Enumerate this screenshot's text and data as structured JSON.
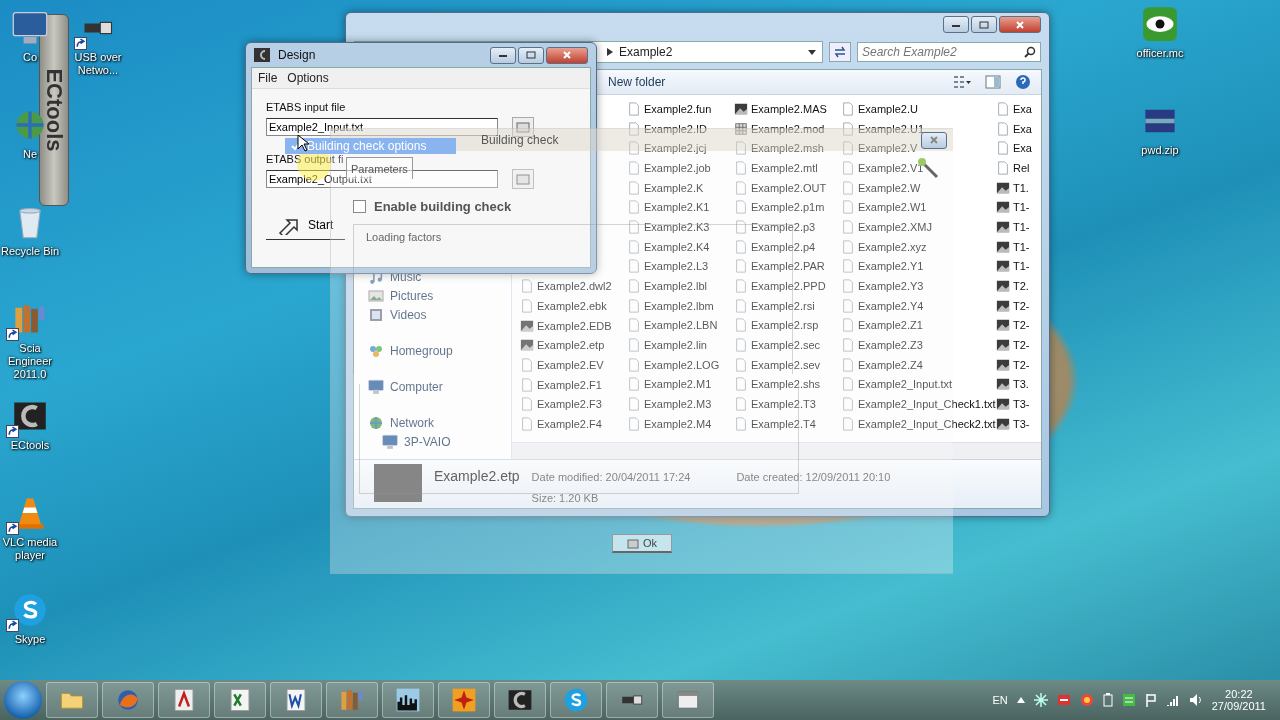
{
  "desktop": {
    "left_columns": [
      [
        {
          "label": "Co",
          "kind": "computer",
          "shortcut": false
        },
        {
          "label": "Ne",
          "kind": "network",
          "shortcut": false
        },
        {
          "label": "Recycle Bin",
          "kind": "recycle",
          "shortcut": false
        },
        {
          "label": "Scia Engineer 2011.0",
          "kind": "books",
          "shortcut": true
        },
        {
          "label": "ECtools",
          "kind": "ec",
          "shortcut": true
        },
        {
          "label": "VLC media player",
          "kind": "cone",
          "shortcut": true
        },
        {
          "label": "Skype",
          "kind": "skype",
          "shortcut": true
        }
      ],
      [
        {
          "label": "USB over Netwo...",
          "kind": "usb",
          "shortcut": true
        }
      ]
    ],
    "right_column": [
      {
        "label": "officer.mc",
        "kind": "eye",
        "shortcut": false
      },
      {
        "label": "pwd.zip",
        "kind": "archive",
        "shortcut": false
      }
    ],
    "gadget": {
      "label": "ECtools"
    }
  },
  "explorer": {
    "address": "Example2",
    "search": {
      "placeholder": "Search Example2"
    },
    "toolbar": [
      "New folder"
    ],
    "nav": [
      [
        {
          "label": "Music",
          "kind": "music"
        },
        {
          "label": "Pictures",
          "kind": "pictures"
        },
        {
          "label": "Videos",
          "kind": "videos"
        }
      ],
      [
        {
          "label": "Homegroup",
          "kind": "homegroup"
        }
      ],
      [
        {
          "label": "Computer",
          "kind": "pc"
        }
      ],
      [
        {
          "label": "Network",
          "kind": "network",
          "children": [
            {
              "label": "3P-VAIO",
              "kind": "pc"
            }
          ]
        }
      ]
    ],
    "columns": [
      [
        {
          "name": "Example2.dwl2",
          "kind": "page"
        },
        {
          "name": "Example2.ebk",
          "kind": "page"
        },
        {
          "name": "Example2.EDB",
          "kind": "picture"
        },
        {
          "name": "Example2.etp",
          "kind": "picture"
        },
        {
          "name": "Example2.EV",
          "kind": "page"
        },
        {
          "name": "Example2.F1",
          "kind": "page"
        },
        {
          "name": "Example2.F3",
          "kind": "page"
        },
        {
          "name": "Example2.F4",
          "kind": "page"
        }
      ],
      [
        {
          "name": "Example2.fun",
          "kind": "page"
        },
        {
          "name": "Example2.ID",
          "kind": "page"
        },
        {
          "name": "Example2.jcj",
          "kind": "page"
        },
        {
          "name": "Example2.job",
          "kind": "page"
        },
        {
          "name": "Example2.K",
          "kind": "page"
        },
        {
          "name": "Example2.K1",
          "kind": "page"
        },
        {
          "name": "Example2.K3",
          "kind": "page"
        },
        {
          "name": "Example2.K4",
          "kind": "page"
        },
        {
          "name": "Example2.L3",
          "kind": "page"
        },
        {
          "name": "Example2.lbl",
          "kind": "page"
        },
        {
          "name": "Example2.lbm",
          "kind": "page"
        },
        {
          "name": "Example2.LBN",
          "kind": "page"
        },
        {
          "name": "Example2.lin",
          "kind": "page"
        },
        {
          "name": "Example2.LOG",
          "kind": "page"
        },
        {
          "name": "Example2.M1",
          "kind": "page"
        },
        {
          "name": "Example2.M3",
          "kind": "page"
        },
        {
          "name": "Example2.M4",
          "kind": "page"
        }
      ],
      [
        {
          "name": "Example2.MAS",
          "kind": "picture"
        },
        {
          "name": "Example2.mod",
          "kind": "grid"
        },
        {
          "name": "Example2.msh",
          "kind": "page"
        },
        {
          "name": "Example2.mtl",
          "kind": "page"
        },
        {
          "name": "Example2.OUT",
          "kind": "page"
        },
        {
          "name": "Example2.p1m",
          "kind": "page"
        },
        {
          "name": "Example2.p3",
          "kind": "page"
        },
        {
          "name": "Example2.p4",
          "kind": "page"
        },
        {
          "name": "Example2.PAR",
          "kind": "page"
        },
        {
          "name": "Example2.PPD",
          "kind": "page"
        },
        {
          "name": "Example2.rsi",
          "kind": "page"
        },
        {
          "name": "Example2.rsp",
          "kind": "page"
        },
        {
          "name": "Example2.sec",
          "kind": "page"
        },
        {
          "name": "Example2.sev",
          "kind": "page"
        },
        {
          "name": "Example2.shs",
          "kind": "page"
        },
        {
          "name": "Example2.T3",
          "kind": "page"
        },
        {
          "name": "Example2.T4",
          "kind": "page"
        }
      ],
      [
        {
          "name": "Example2.U",
          "kind": "page"
        },
        {
          "name": "Example2.U1",
          "kind": "page"
        },
        {
          "name": "Example2.V",
          "kind": "page"
        },
        {
          "name": "Example2.V1",
          "kind": "page"
        },
        {
          "name": "Example2.W",
          "kind": "page"
        },
        {
          "name": "Example2.W1",
          "kind": "page"
        },
        {
          "name": "Example2.XMJ",
          "kind": "page"
        },
        {
          "name": "Example2.xyz",
          "kind": "page"
        },
        {
          "name": "Example2.Y1",
          "kind": "page"
        },
        {
          "name": "Example2.Y3",
          "kind": "page"
        },
        {
          "name": "Example2.Y4",
          "kind": "page"
        },
        {
          "name": "Example2.Z1",
          "kind": "page"
        },
        {
          "name": "Example2.Z3",
          "kind": "page"
        },
        {
          "name": "Example2.Z4",
          "kind": "page"
        },
        {
          "name": "Example2_Input.txt",
          "kind": "page"
        },
        {
          "name": "Example2_Input_Check1.txt",
          "kind": "page"
        },
        {
          "name": "Example2_Input_Check2.txt",
          "kind": "page"
        }
      ],
      [
        {
          "name": "Exa",
          "kind": "page"
        },
        {
          "name": "Exa",
          "kind": "page"
        },
        {
          "name": "Exa",
          "kind": "page"
        },
        {
          "name": "Rel",
          "kind": "page"
        },
        {
          "name": "T1.",
          "kind": "picture"
        },
        {
          "name": "T1-",
          "kind": "picture"
        },
        {
          "name": "T1-",
          "kind": "picture"
        },
        {
          "name": "T1-",
          "kind": "picture"
        },
        {
          "name": "T1-",
          "kind": "picture"
        },
        {
          "name": "T2.",
          "kind": "picture"
        },
        {
          "name": "T2-",
          "kind": "picture"
        },
        {
          "name": "T2-",
          "kind": "picture"
        },
        {
          "name": "T2-",
          "kind": "picture"
        },
        {
          "name": "T2-",
          "kind": "picture"
        },
        {
          "name": "T3.",
          "kind": "picture"
        },
        {
          "name": "T3-",
          "kind": "picture"
        },
        {
          "name": "T3-",
          "kind": "picture"
        }
      ]
    ],
    "details": {
      "name": "Example2.etp",
      "modified": "Date modified: 20/04/2011 17:24",
      "created": "Date created: 12/09/2011 20:10",
      "size": "Size: 1.20 KB"
    }
  },
  "design": {
    "title": "Design",
    "menu": [
      "File",
      "Options"
    ],
    "input_label": "ETABS input file",
    "input_value": "Example2_Input.txt",
    "output_label": "ETABS output fi",
    "output_value": "Example2_Output.txt",
    "start": "Start",
    "drag_item": {
      "label": "Building check options",
      "checked": true
    }
  },
  "building_check": {
    "title": "Building check",
    "tabs": [
      {
        "label": "Parameters",
        "selected": true
      }
    ],
    "enable": {
      "label": "Enable building check",
      "checked": false
    },
    "loading": {
      "title": "Loading factors"
    },
    "ok": "Ok"
  },
  "taskbar": {
    "apps": [
      {
        "kind": "folder"
      },
      {
        "kind": "globe"
      },
      {
        "kind": "pdf"
      },
      {
        "kind": "spreadsheet"
      },
      {
        "kind": "word"
      },
      {
        "kind": "books"
      },
      {
        "kind": "chart"
      },
      {
        "kind": "star"
      },
      {
        "kind": "ec"
      },
      {
        "kind": "skype"
      },
      {
        "kind": "usb"
      },
      {
        "kind": "window"
      }
    ],
    "language": "EN",
    "time": "20:22",
    "date": "27/09/2011"
  }
}
